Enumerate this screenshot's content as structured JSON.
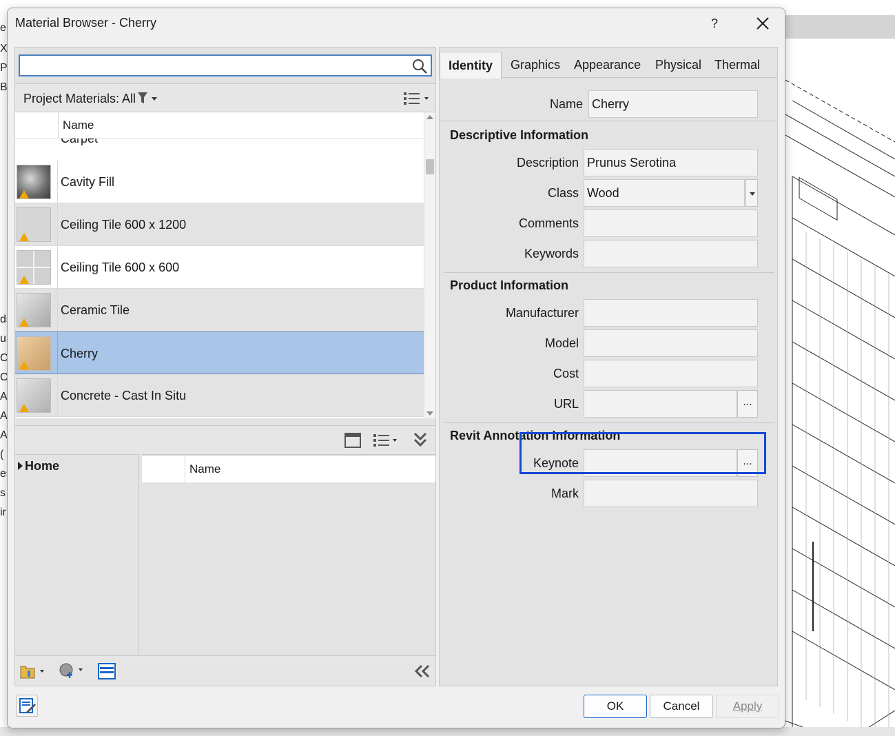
{
  "background": {
    "left_fragments": [
      "er",
      "XL",
      "P",
      "B",
      "ds",
      "ul",
      "O(",
      "O(",
      "AL",
      "AL",
      "AL",
      "(",
      "es",
      "s",
      "ir"
    ]
  },
  "dialog": {
    "title": "Material Browser - Cherry",
    "help_label": "?",
    "buttons": {
      "ok": "OK",
      "cancel": "Cancel",
      "apply": "Apply"
    }
  },
  "browser": {
    "search": {
      "value": "",
      "placeholder": ""
    },
    "project_materials_label": "Project Materials: All",
    "list_header": "Name",
    "materials": [
      {
        "name": "Carpet",
        "icon": "carpet-swatch"
      },
      {
        "name": "Cavity Fill",
        "icon": "cavity-fill-swatch"
      },
      {
        "name": "Ceiling Tile 600 x 1200",
        "icon": "ceiling-tile-swatch"
      },
      {
        "name": "Ceiling Tile 600 x 600",
        "icon": "ceiling-tile-swatch"
      },
      {
        "name": "Ceramic Tile",
        "icon": "ceramic-tile-swatch"
      },
      {
        "name": "Cherry",
        "icon": "cherry-wood-swatch",
        "selected": true
      },
      {
        "name": "Concrete - Cast In Situ",
        "icon": "concrete-swatch"
      }
    ],
    "library": {
      "tree_root": "Home",
      "list_header": "Name"
    }
  },
  "editor": {
    "tabs": [
      "Identity",
      "Graphics",
      "Appearance",
      "Physical",
      "Thermal"
    ],
    "active_tab": "Identity",
    "name_label": "Name",
    "name_value": "Cherry",
    "descriptive": {
      "title": "Descriptive Information",
      "description_label": "Description",
      "description_value": "Prunus Serotina",
      "class_label": "Class",
      "class_value": "Wood",
      "comments_label": "Comments",
      "comments_value": "",
      "keywords_label": "Keywords",
      "keywords_value": ""
    },
    "product": {
      "title": "Product Information",
      "manufacturer_label": "Manufacturer",
      "manufacturer_value": "",
      "model_label": "Model",
      "model_value": "",
      "cost_label": "Cost",
      "cost_value": "",
      "url_label": "URL",
      "url_value": "",
      "url_browse": "..."
    },
    "annotation": {
      "title": "Revit Annotation Information",
      "keynote_label": "Keynote",
      "keynote_value": "",
      "keynote_browse": "...",
      "mark_label": "Mark",
      "mark_value": ""
    }
  },
  "colors": {
    "accent": "#1449d6",
    "selection": "#a9c5e8",
    "warning": "#f0a500"
  }
}
